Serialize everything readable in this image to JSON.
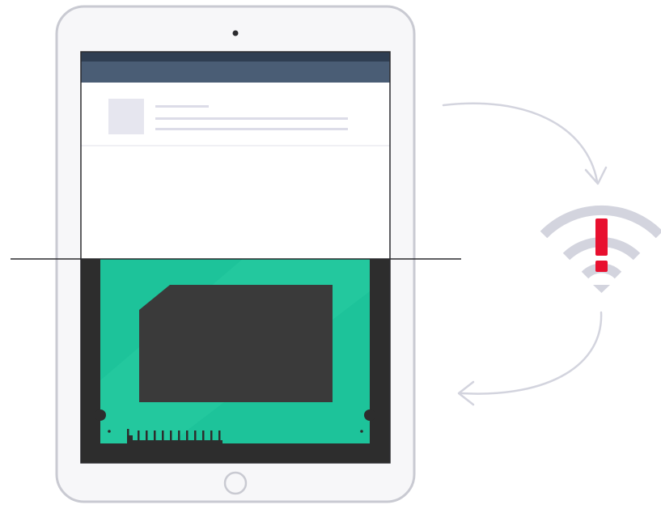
{
  "colors": {
    "device_frame_fill": "#f7f7f9",
    "device_frame_stroke": "#c9cad2",
    "camera": "#2b2b2f",
    "app_header": "#4a5d75",
    "app_header_top": "#2f3e52",
    "screen_bg": "#ffffff",
    "placeholder_fill": "#e6e6ef",
    "placeholder_line": "#dcdce8",
    "divider": "#2b2b2f",
    "memory_bezel": "#2d2d2d",
    "memory_board": "#1dc39a",
    "memory_chip": "#3a3a3a",
    "memory_pins": "#2d2d2d",
    "arrow": "#d3d4de",
    "wifi_arcs": "#d3d4de",
    "alert": "#e8102f"
  },
  "icons": {
    "device": "tablet-icon",
    "memory": "memory-module-icon",
    "connectivity": "wifi-icon",
    "alert": "exclamation-icon",
    "home": "home-button-icon"
  }
}
